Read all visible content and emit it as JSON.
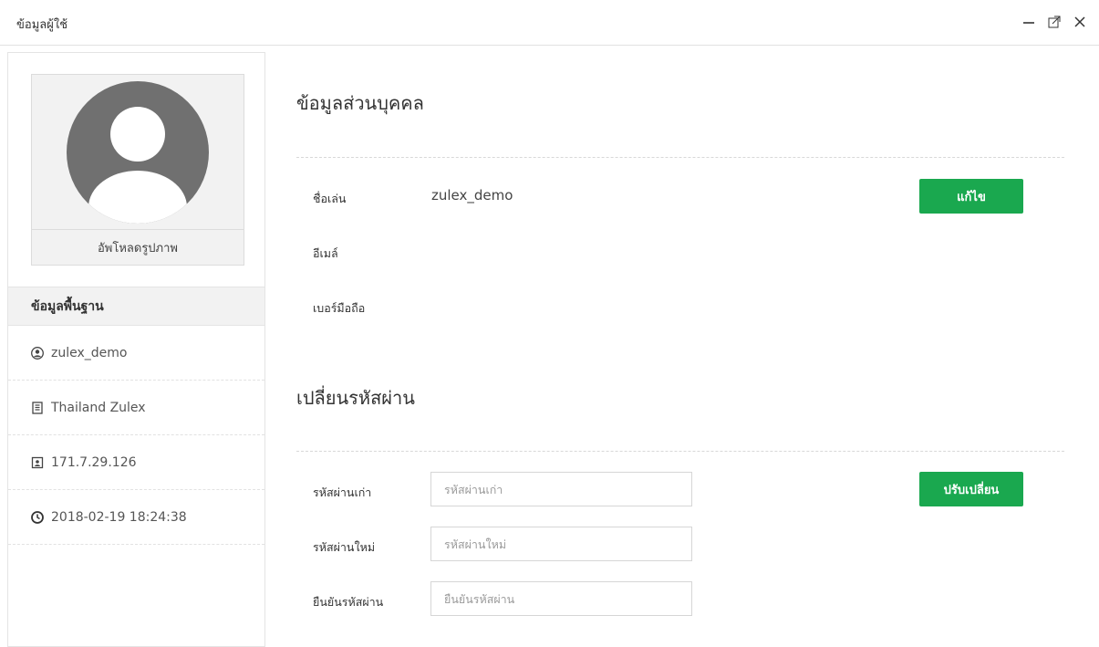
{
  "window": {
    "title": "ข้อมูลผู้ใช้"
  },
  "avatar": {
    "upload_label": "อัพโหลดรูปภาพ"
  },
  "basic_info": {
    "header": "ข้อมูลพื้นฐาน",
    "items": [
      {
        "icon": "user-circle-icon",
        "text": "zulex_demo"
      },
      {
        "icon": "building-icon",
        "text": "Thailand Zulex"
      },
      {
        "icon": "id-card-icon",
        "text": "171.7.29.126"
      },
      {
        "icon": "clock-icon",
        "text": "2018-02-19 18:24:38"
      }
    ]
  },
  "personal": {
    "title": "ข้อมูลส่วนบุคคล",
    "nickname_label": "ชื่อเล่น",
    "nickname_value": "zulex_demo",
    "email_label": "อีเมล์",
    "phone_label": "เบอร์มือถือ",
    "edit_button": "แก้ไข"
  },
  "password": {
    "title": "เปลี่ยนรหัสผ่าน",
    "old_label": "รหัสผ่านเก่า",
    "old_placeholder": "รหัสผ่านเก่า",
    "new_label": "รหัสผ่านใหม่",
    "new_placeholder": "รหัสผ่านใหม่",
    "confirm_label": "ยืนยันรหัสผ่าน",
    "confirm_placeholder": "ยืนยันรหัสผ่าน",
    "change_button": "ปรับเปลี่ยน"
  },
  "colors": {
    "accent_green": "#1aa84f",
    "avatar_gray": "#707070"
  }
}
